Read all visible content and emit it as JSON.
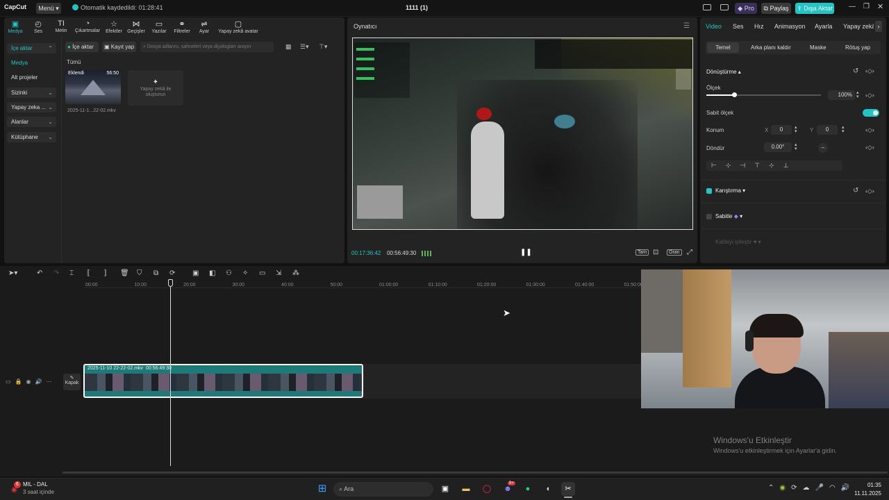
{
  "app": {
    "logo": "CapCut",
    "menu_label": "Menü",
    "autosave": "Otomatik kaydedildi: 01:28:41",
    "project_title": "1111 (1)",
    "pro_label": "Pro",
    "share_label": "Paylaş",
    "export_label": "Dışa Aktar"
  },
  "media_tools": [
    {
      "label": "Medya",
      "icon": "media-icon"
    },
    {
      "label": "Ses",
      "icon": "audio-icon"
    },
    {
      "label": "Metin",
      "icon": "text-icon"
    },
    {
      "label": "Çıkartmalar",
      "icon": "sticker-icon"
    },
    {
      "label": "Efektler",
      "icon": "effects-icon"
    },
    {
      "label": "Geçişler",
      "icon": "transition-icon"
    },
    {
      "label": "Yazılar",
      "icon": "captions-icon"
    },
    {
      "label": "Filtreler",
      "icon": "filter-icon"
    },
    {
      "label": "Ayar",
      "icon": "adjust-icon"
    },
    {
      "label": "Yapay zekâ avatar",
      "icon": "ai-avatar-icon"
    }
  ],
  "media_sidebar": [
    {
      "label": "İçe aktar"
    },
    {
      "label": "Medya"
    },
    {
      "label": "Alt projeler"
    },
    {
      "label": "Sizinki"
    },
    {
      "label": "Yapay zeka ..."
    },
    {
      "label": "Alanlar"
    },
    {
      "label": "Kütüphane"
    }
  ],
  "media_panel": {
    "import_label": "İçe aktar",
    "record_label": "Kayıt yap",
    "search_placeholder": "Dosya adlarını, sahneleri veya diyalogları arayın",
    "filter_all": "Tümü",
    "clip_badge": "Eklendi",
    "clip_duration": "56:50",
    "clip_name": "2025-11-1...22-02.mkv",
    "ai_card_label": "Yapay zekâ ile oluşturun"
  },
  "player": {
    "title": "Oynatıcı",
    "current_time": "00:17:36:42",
    "total_time": "00:56:49:30",
    "full_label": "Tam",
    "ratio_label": "Oran"
  },
  "props": {
    "tabs": [
      "Video",
      "Ses",
      "Hız",
      "Animasyon",
      "Ayarla",
      "Yapay zekâ"
    ],
    "subtabs": [
      "Temel",
      "Arka planı kaldır",
      "Maske",
      "Rötuş yap"
    ],
    "transform_label": "Dönüştürme",
    "scale_label": "Ölçek",
    "scale_value": "100%",
    "scale_fraction": 0.24,
    "uniform_scale_label": "Sabit ölçek",
    "position_label": "Konum",
    "pos_x_label": "X",
    "pos_x": "0",
    "pos_y_label": "Y",
    "pos_y": "0",
    "rotate_label": "Döndür",
    "rotate_value": "0.00°",
    "blend_label": "Karıştırma",
    "stabilize_label": "Sabitle",
    "quality_label": "Kaliteyi iyileştir"
  },
  "timeline": {
    "ruler": [
      "00:00",
      "10:00",
      "20:00",
      "30:00",
      "40:00",
      "50:00",
      "01:00:00",
      "01:10:00",
      "01:20:00",
      "01:30:00",
      "01:40:00",
      "01:50:00"
    ],
    "cover_label": "Kapak",
    "clip_label": "2025-11-10 22-22-02.mkv  00:56:49:30"
  },
  "watermark": {
    "line1": "Windows'u Etkinleştir",
    "line2": "Windows'u etkinleştirmek için Ayarlar'a gidin."
  },
  "taskbar": {
    "weather_title": "MIL - DAL",
    "weather_sub": "3 saat içinde",
    "weather_badge": "6",
    "search_label": "Ara",
    "discord_badge": "9+",
    "time": "01:35",
    "date": "11.11.2025"
  },
  "colors": {
    "accent": "#1fc6c3",
    "export": "#1fc6c3"
  }
}
